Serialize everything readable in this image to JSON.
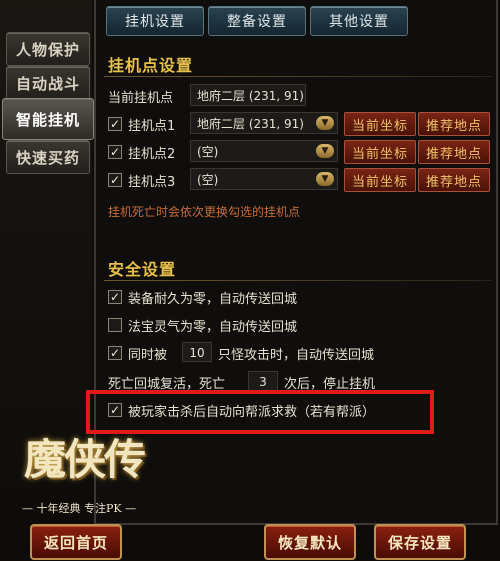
{
  "side_tabs": [
    "人物保护",
    "自动战斗",
    "智能挂机",
    "快速买药"
  ],
  "top_tabs": [
    "挂机设置",
    "整备设置",
    "其他设置"
  ],
  "hang_section": {
    "title": "挂机点设置",
    "current_label": "当前挂机点",
    "current_value": "地府二层 (231, 91)",
    "points": [
      {
        "label": "挂机点1",
        "value": "地府二层 (231, 91)",
        "checked": true
      },
      {
        "label": "挂机点2",
        "value": "(空)",
        "checked": true
      },
      {
        "label": "挂机点3",
        "value": "(空)",
        "checked": true
      }
    ],
    "btn_current": "当前坐标",
    "btn_recommend": "推荐地点",
    "note": "挂机死亡时会依次更换勾选的挂机点"
  },
  "safety_section": {
    "title": "安全设置",
    "opt1": "装备耐久为零，自动传送回城",
    "opt2": "法宝灵气为零，自动传送回城",
    "opt3_a": "同时被",
    "opt3_num": "10",
    "opt3_b": "只怪攻击时，自动传送回城",
    "revive_a": "死亡回城复活，死亡",
    "revive_num": "3",
    "revive_b": "次后，停止挂机",
    "opt5": "被玩家击杀后自动向帮派求救（若有帮派）"
  },
  "logo": {
    "main": "魔侠传",
    "sub": "— 十年经典  专注PK —"
  },
  "bottom": {
    "back": "返回首页",
    "reset": "恢复默认",
    "save": "保存设置"
  }
}
